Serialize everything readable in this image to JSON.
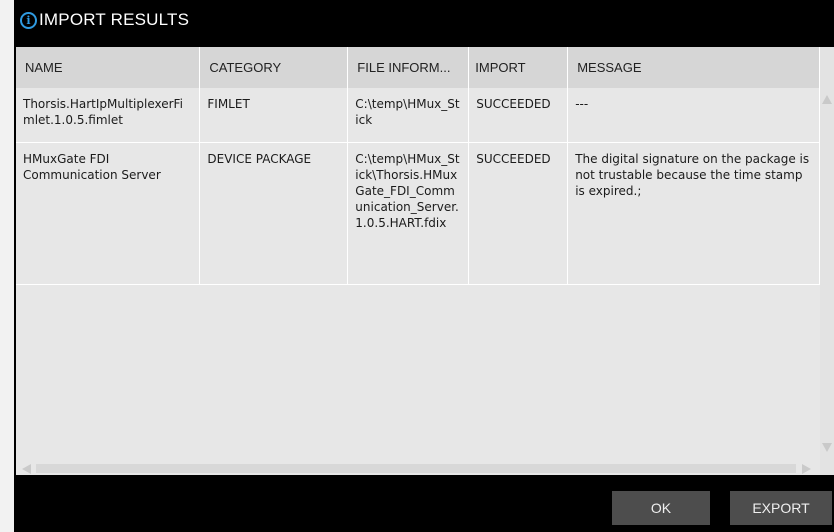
{
  "dialog": {
    "title": "IMPORT RESULTS",
    "icon": "info-icon"
  },
  "table": {
    "columns": [
      "NAME",
      "CATEGORY",
      "FILE INFORM...",
      "IMPORT",
      "MESSAGE"
    ],
    "rows": [
      {
        "name": "Thorsis.HartIpMultiplexerFimlet.1.0.5.fimlet",
        "category": "FIMLET",
        "file": "C:\\temp\\HMux_Stick",
        "import": "SUCCEEDED",
        "message": "---"
      },
      {
        "name": "HMuxGate FDI Communication Server",
        "category": "DEVICE PACKAGE",
        "file": "C:\\temp\\HMux_Stick\\Thorsis.HMuxGate_FDI_Communication_Server.1.0.5.HART.fdix",
        "import": "SUCCEEDED",
        "message": "The digital signature on the package is not trustable because the time stamp is expired.;"
      }
    ]
  },
  "buttons": {
    "ok": "OK",
    "export": "EXPORT"
  },
  "colors": {
    "title_bar": "#000000",
    "accent_icon": "#2f9ae0",
    "button_bg": "#4d4d4d",
    "grid_bg": "#e7e7e7",
    "header_bg": "#d6d6d6"
  }
}
